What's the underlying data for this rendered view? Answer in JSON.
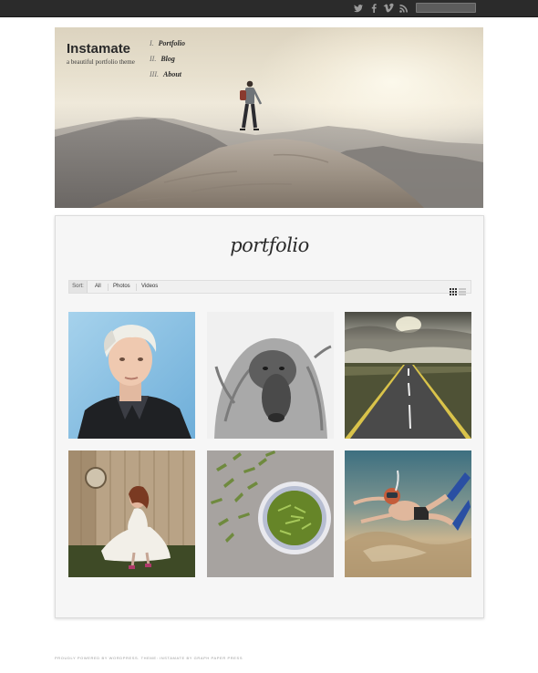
{
  "site": {
    "title": "Instamate",
    "tagline": "a beautiful portfolio theme"
  },
  "topbar": {
    "social_icons": [
      "twitter-icon",
      "facebook-icon",
      "vimeo-icon",
      "rss-icon"
    ],
    "search_placeholder": ""
  },
  "nav": {
    "items": [
      {
        "num": "I.",
        "label": "Portfolio"
      },
      {
        "num": "II.",
        "label": "Blog"
      },
      {
        "num": "III.",
        "label": "About"
      }
    ]
  },
  "portfolio": {
    "heading": "portfolio",
    "sort_label": "Sort:",
    "filters": [
      "All",
      "Photos",
      "Videos"
    ],
    "view_modes": [
      "grid-view-icon",
      "list-view-icon"
    ]
  },
  "gallery": {
    "items": [
      {
        "subject": "portrait-photo"
      },
      {
        "subject": "baboon-photo"
      },
      {
        "subject": "road-photo"
      },
      {
        "subject": "woman-porch-photo"
      },
      {
        "subject": "green-tea-photo"
      },
      {
        "subject": "diver-photo"
      }
    ]
  },
  "footer": {
    "text": "PROUDLY POWERED BY WORDPRESS. THEME: INSTAMATE BY GRAPH PAPER PRESS"
  },
  "colors": {
    "topbar": "#2b2b2b",
    "card_bg": "#f6f6f6",
    "page_bg": "#ffffff"
  }
}
